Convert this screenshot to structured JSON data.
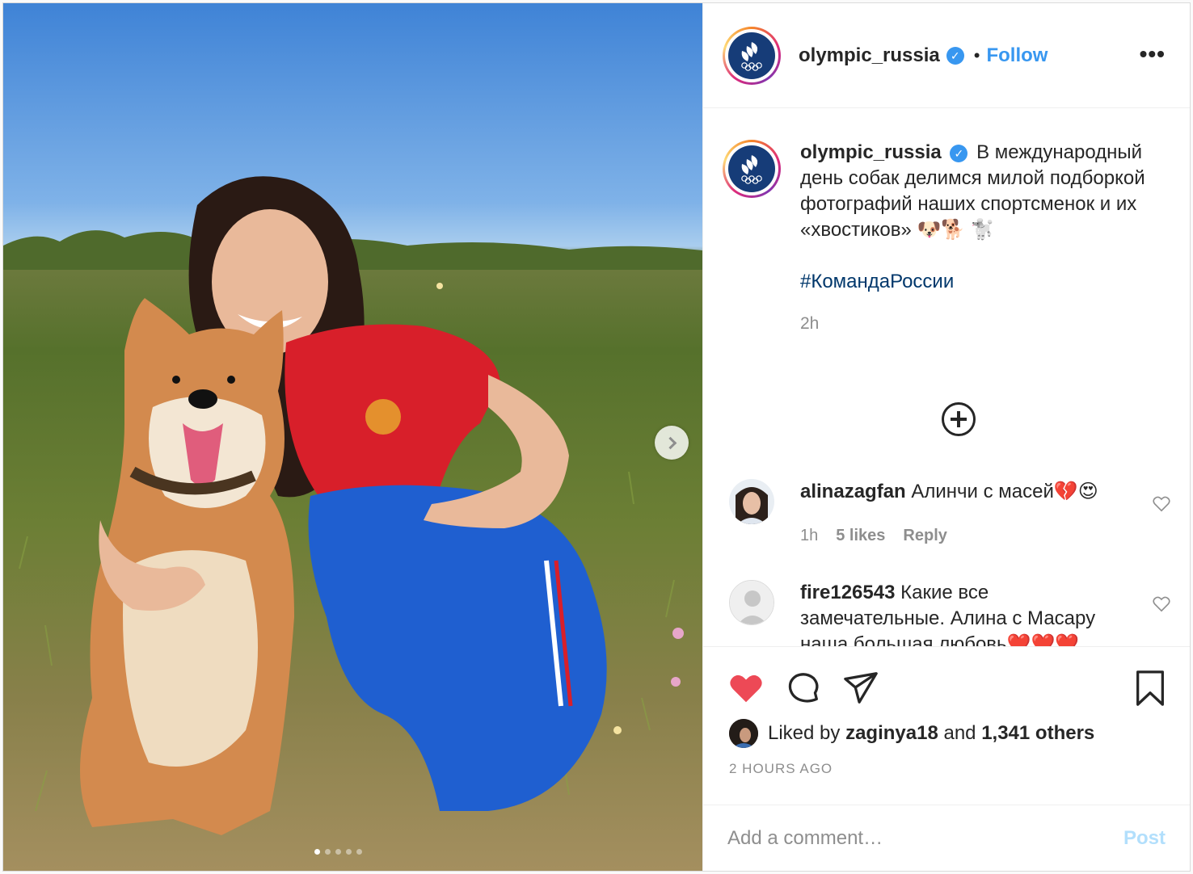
{
  "post": {
    "username": "olympic_russia",
    "verified": true,
    "follow_label": "Follow",
    "bullet": "•",
    "more_label": "•••"
  },
  "caption": {
    "username": "olympic_russia",
    "text": "В международный день собак делимся милой подборкой фотографий наших спортсменок и их «хвостиков» 🐶🐕 🐩",
    "hashtag": "#КомандаРоссии",
    "time": "2h"
  },
  "comments": [
    {
      "username": "alinazagfan",
      "text": "Алинчи с масей💔😍",
      "time": "1h",
      "likes": "5 likes",
      "reply": "Reply"
    },
    {
      "username": "fire126543",
      "text": "Какие все замечательные. Алина с Масару наша большая любовь❤️❤️❤️"
    }
  ],
  "likes": {
    "prefix": "Liked by",
    "user": "zaginya18",
    "and": "and",
    "others": "1,341 others"
  },
  "timestamp": "2 HOURS AGO",
  "add_comment": {
    "placeholder": "Add a comment…",
    "post_label": "Post"
  },
  "colors": {
    "accent": "#3897f0",
    "like_red": "#ed4956",
    "hashtag": "#00376b",
    "post_disabled": "#b2dffc"
  },
  "icons": [
    "verified-badge-icon",
    "more-options-icon",
    "add-circle-icon",
    "heart-icon",
    "comment-icon",
    "share-icon",
    "bookmark-icon",
    "carousel-next-icon"
  ]
}
